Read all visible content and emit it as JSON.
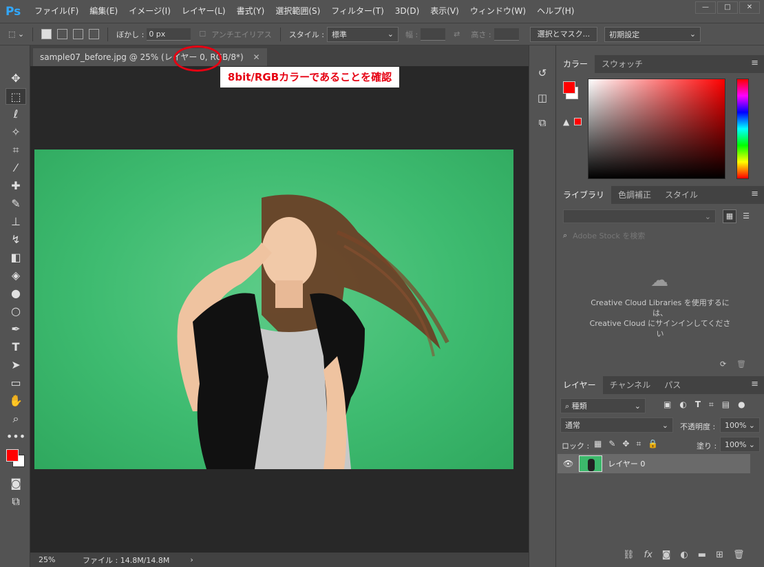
{
  "app": {
    "logo": "Ps",
    "menu": [
      "ファイル(F)",
      "編集(E)",
      "イメージ(I)",
      "レイヤー(L)",
      "書式(Y)",
      "選択範囲(S)",
      "フィルター(T)",
      "3D(D)",
      "表示(V)",
      "ウィンドウ(W)",
      "ヘルプ(H)"
    ]
  },
  "options": {
    "feather_label": "ぼかし :",
    "feather_value": "0 px",
    "antialias": "アンチエイリアス",
    "style_label": "スタイル :",
    "style_value": "標準",
    "width_label": "幅 :",
    "height_label": "高さ :",
    "select_mask_button": "選択とマスク...",
    "workspace": "初期設定"
  },
  "document": {
    "tab_title": "sample07_before.jpg @ 25% (レイヤー 0, RGB/8*)",
    "zoom": "25%",
    "file_info": "ファイル : 14.8M/14.8M"
  },
  "annotation": {
    "text": "8bit/RGBカラーであることを確認",
    "color": "#e60012"
  },
  "color_panel": {
    "tabs": [
      "カラー",
      "スウォッチ"
    ],
    "foreground": "#ff0000",
    "background": "#ffffff"
  },
  "libraries_panel": {
    "tabs": [
      "ライブラリ",
      "色調補正",
      "スタイル"
    ],
    "search_placeholder": "Adobe Stock を検索",
    "message_line1": "Creative Cloud Libraries を使用するに",
    "message_line2": "は、",
    "message_line3": "Creative Cloud にサインインしてくださ",
    "message_line4": "い"
  },
  "layers_panel": {
    "tabs": [
      "レイヤー",
      "チャンネル",
      "パス"
    ],
    "filter_kind": "種類",
    "blend_mode": "通常",
    "opacity_label": "不透明度 :",
    "opacity_value": "100%",
    "lock_label": "ロック :",
    "fill_label": "塗り :",
    "fill_value": "100%",
    "layers": [
      {
        "name": "レイヤー 0"
      }
    ]
  }
}
